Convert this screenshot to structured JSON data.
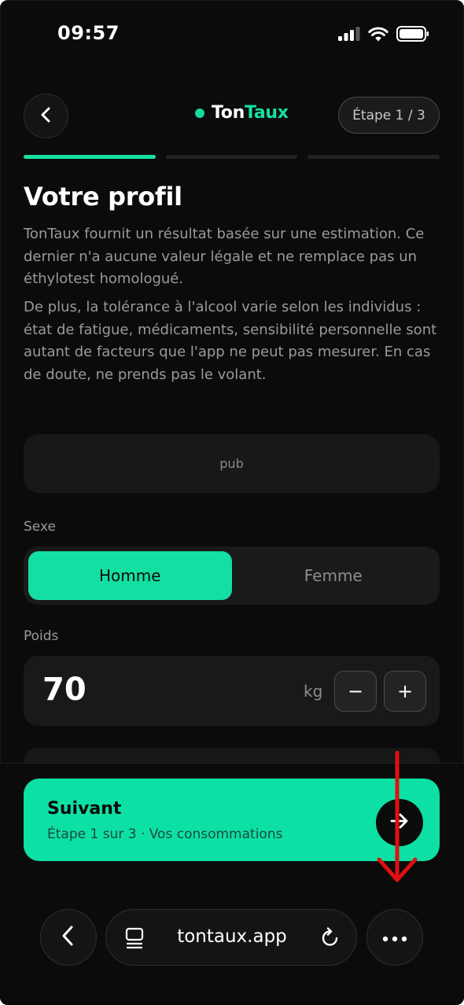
{
  "status_bar": {
    "time": "09:57",
    "icons": [
      "signal-icon",
      "wifi-icon",
      "battery-icon"
    ]
  },
  "header": {
    "back_icon": "chevron-left-icon",
    "brand_part1": "Ton",
    "brand_part2": "Taux",
    "step_label": "Étape 1 / 3"
  },
  "progress": {
    "current_step": 1,
    "total_steps": 3
  },
  "page": {
    "title": "Votre profil",
    "disclaimer_1": "TonTaux fournit un résultat basée sur une estimation. Ce dernier n'a aucune valeur légale et ne remplace pas un éthylotest homologué.",
    "disclaimer_2": "De plus, la tolérance à l'alcool varie selon les individus : état de fatigue, médicaments, sensibilité personnelle sont autant de facteurs que l'app ne peut pas mesurer. En cas de doute, ne prends pas le volant.",
    "ad_label": "pub"
  },
  "form": {
    "sex_label": "Sexe",
    "sex_options": [
      "Homme",
      "Femme"
    ],
    "sex_selected": "Homme",
    "weight_label": "Poids",
    "weight_value": "70",
    "weight_unit": "kg",
    "decrement_label": "−",
    "increment_label": "+"
  },
  "cta": {
    "title": "Suivant",
    "subtitle": "Étape 1 sur 3 · Vos consommations",
    "icon": "arrow-right-icon"
  },
  "browser": {
    "url": "tontaux.app",
    "icons": [
      "chevron-left-icon",
      "tabs-icon",
      "reload-icon",
      "more-icon"
    ]
  },
  "colors": {
    "accent": "#14DFA3",
    "background": "#0B0B0B",
    "card": "#191919",
    "annotation": "#E01010"
  }
}
